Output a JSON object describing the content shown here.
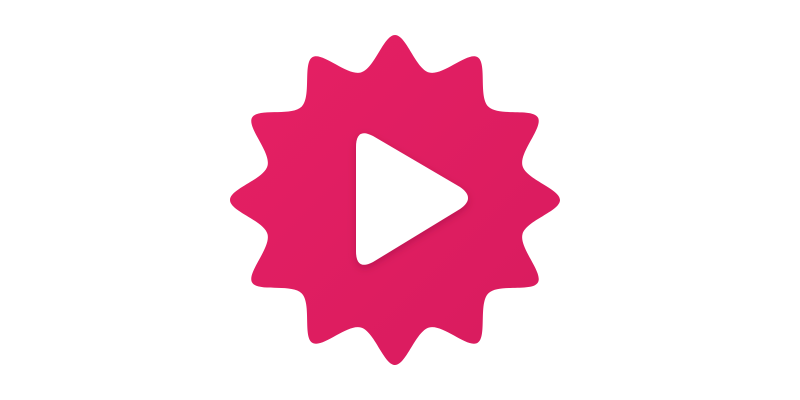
{
  "logo": {
    "name": "play-badge-logo",
    "icon": "play-icon",
    "colors": {
      "badge_top": "#E62064",
      "badge_bottom": "#D81B5E",
      "play": "#FFFFFF",
      "background": "#FFFFFF"
    },
    "badge_points": 12
  }
}
